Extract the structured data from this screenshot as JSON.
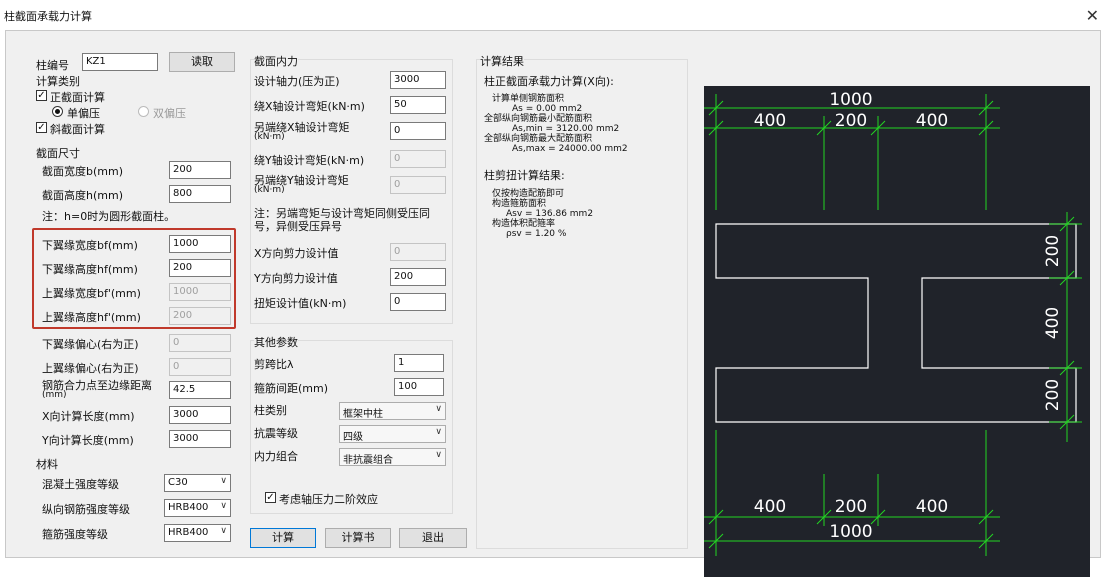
{
  "window": {
    "title": "柱截面承载力计算",
    "close_icon": "close-icon"
  },
  "left": {
    "col_no_label": "柱编号",
    "col_no_value": "KZ1",
    "read_button": "读取",
    "calc_type_label": "计算类别",
    "normal_section": "正截面计算",
    "single_ecc": "单偏压",
    "double_ecc": "双偏压",
    "oblique_section": "斜截面计算",
    "section_size_label": "截面尺寸",
    "width_label": "截面宽度b(mm)",
    "width_value": "200",
    "height_label": "截面高度h(mm)",
    "height_value": "800",
    "note": "注：h=0时为圆形截面柱。",
    "bf_label": "下翼缘宽度bf(mm)",
    "bf_value": "1000",
    "hf_label": "下翼缘高度hf(mm)",
    "hf_value": "200",
    "bf2_label": "上翼缘宽度bf'(mm)",
    "bf2_value": "1000",
    "hf2_label": "上翼缘高度hf'(mm)",
    "hf2_value": "200",
    "ecc_low_label": "下翼缘偏心(右为正)",
    "ecc_low_value": "0",
    "ecc_up_label": "上翼缘偏心(右为正)",
    "ecc_up_value": "0",
    "rebar_dist_label": "钢筋合力点至边缘距离",
    "rebar_dist_unit": "(mm)",
    "rebar_dist_value": "42.5",
    "x_len_label": "X向计算长度(mm)",
    "x_len_value": "3000",
    "y_len_label": "Y向计算长度(mm)",
    "y_len_value": "3000",
    "material_label": "材料",
    "concrete_label": "混凝土强度等级",
    "concrete_value": "C30",
    "long_rebar_label": "纵向钢筋强度等级",
    "long_rebar_value": "HRB400",
    "stirrup_label": "箍筋强度等级",
    "stirrup_value": "HRB400"
  },
  "mid": {
    "forces_label": "截面内力",
    "axial_label": "设计轴力(压为正)",
    "axial_value": "3000",
    "mx_label": "绕X轴设计弯矩(kN·m)",
    "mx_value": "50",
    "mx2_label": "另端绕X轴设计弯矩",
    "mx2_unit": "(kN·m)",
    "mx2_value": "0",
    "my_label": "绕Y轴设计弯矩(kN·m)",
    "my_value": "0",
    "my2_label": "另端绕Y轴设计弯矩",
    "my2_unit": "(kN·m)",
    "my2_value": "0",
    "note1": "注：另端弯矩与设计弯矩同侧受压同",
    "note2": "号，异侧受压异号",
    "vx_label": "X方向剪力设计值",
    "vx_value": "0",
    "vy_label": "Y方向剪力设计值",
    "vy_value": "200",
    "t_label": "扭矩设计值(kN·m)",
    "t_value": "0",
    "other_label": "其他参数",
    "shear_span_label": "剪跨比λ",
    "shear_span_value": "1",
    "stirrup_spacing_label": "箍筋间距(mm)",
    "stirrup_spacing_value": "100",
    "col_type_label": "柱类别",
    "col_type_value": "框架中柱",
    "seismic_label": "抗震等级",
    "seismic_value": "四级",
    "combo_label": "内力组合",
    "combo_value": "非抗震组合",
    "second_order": "考虑轴压力二阶效应",
    "calc_button": "计算",
    "report_button": "计算书",
    "exit_button": "退出"
  },
  "results": {
    "title": "计算结果",
    "normal_title": "柱正截面承载力计算(X向):",
    "single_side": "计算单侧钢筋面积",
    "as_value": "As = 0.00 mm2",
    "min_label": "全部纵向钢筋最小配筋面积",
    "min_value": "As,min = 3120.00 mm2",
    "max_label": "全部纵向钢筋最大配筋面积",
    "max_value": "As,max = 24000.00 mm2",
    "shear_title": "柱剪扭计算结果:",
    "construct": "仅按构造配筋即可",
    "stirrup_area": "构造箍筋面积",
    "asv_value": "Asv = 136.86 mm2",
    "ratio_label": "构造体积配箍率",
    "psv_value": "ρsv = 1.20 %"
  },
  "drawing": {
    "top_total": "1000",
    "top_left": "400",
    "top_mid": "200",
    "top_right": "400",
    "bot_left": "400",
    "bot_mid": "200",
    "bot_right": "400",
    "bot_total": "1000",
    "right_top": "200",
    "right_mid": "400",
    "right_bot": "200",
    "dim_color": "#22d622",
    "outline_color": "#ffffff",
    "bg_color": "#20232a"
  }
}
